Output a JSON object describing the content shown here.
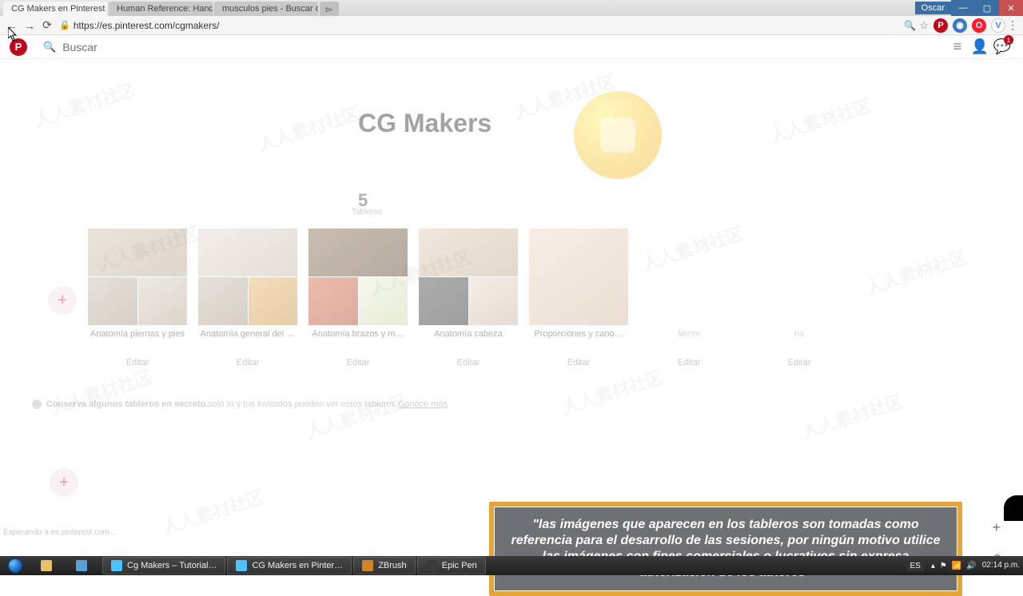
{
  "titlebar": {
    "user": "Oscar",
    "tabs": [
      {
        "label": "CG Makers en Pinterest",
        "favicon_bg": "#bd081c",
        "active": true
      },
      {
        "label": "Human Reference: Hand…",
        "favicon_bg": "#4ba94b",
        "active": false
      },
      {
        "label": "musculos pies - Buscar c…",
        "favicon_bg": "#4285f4",
        "active": false
      }
    ]
  },
  "addrbar": {
    "url": "https://es.pinterest.com/cgmakers/"
  },
  "pin_header": {
    "search_placeholder": "Buscar",
    "notif_count": "1"
  },
  "profile": {
    "title": "CG Makers",
    "stat_number": "5",
    "stat_label": "Tableros"
  },
  "boards": [
    {
      "title": "Anatomía piernas y pies",
      "edit": "Editar"
    },
    {
      "title": "Anatomía general del …",
      "edit": "Editar"
    },
    {
      "title": "Anatomía brazos y m…",
      "edit": "Editar"
    },
    {
      "title": "Anatomía cabeza",
      "edit": "Editar"
    },
    {
      "title": "Proporciones y cano…",
      "edit": "Editar"
    }
  ],
  "phantom_boards": [
    {
      "title": "Mmm",
      "edit": "Editar"
    },
    {
      "title": "na",
      "edit": "Editar"
    }
  ],
  "secret_tip": {
    "bold": "Conserva algunos tableros en secreto.",
    "rest": " solo tú y tus invitados pueden ver estos tableros. ",
    "more": "Conoce más"
  },
  "status": "Esperando a es.pinterest.com…",
  "subtitle": "\"las imágenes que aparecen en los tableros son tomadas como referencia para el desarrollo de las sesiones, por ningún motivo utilice las imágenes con fines comerciales o lucrativos sin expresa autorización de los autores\"",
  "taskbar": {
    "apps": [
      {
        "label": "",
        "icon_bg": "#e8c06a"
      },
      {
        "label": "",
        "icon_bg": "#5aa0d8"
      },
      {
        "label": "Cg Makers – Tutorial…",
        "icon_bg": "#4cc2ff"
      },
      {
        "label": "CG Makers en Pinter…",
        "icon_bg": "#4cc2ff"
      },
      {
        "label": "ZBrush",
        "icon_bg": "#d0842a"
      },
      {
        "label": "Epic Pen",
        "icon_bg": "#3a3a3a"
      }
    ],
    "lang": "ES",
    "time": "02:14 p.m."
  },
  "watermark": "人人素材社区"
}
